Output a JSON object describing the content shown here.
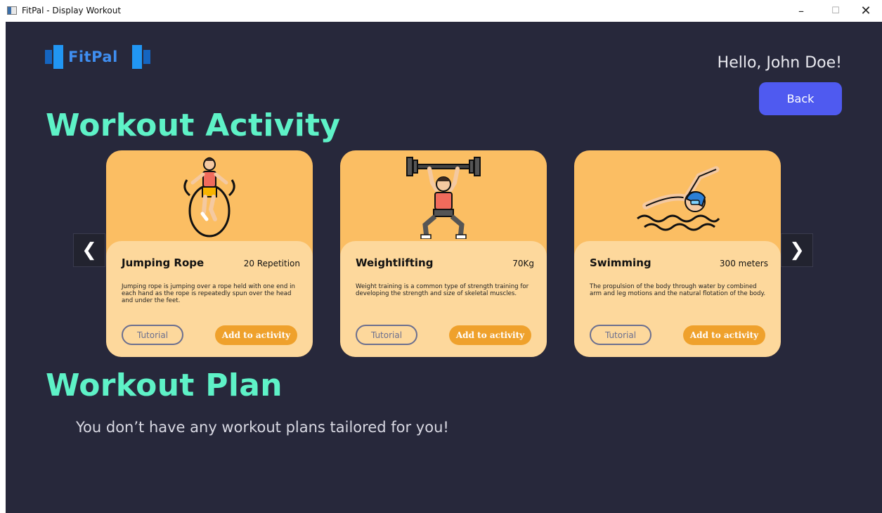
{
  "window": {
    "title": "FitPal - Display Workout",
    "minimize": "–",
    "maximize": "☐",
    "close": "✕"
  },
  "header": {
    "logo_text": "FitPal",
    "greeting": "Hello, John Doe!",
    "back_label": "Back"
  },
  "sections": {
    "activity_title": "Workout Activity",
    "plan_title": "Workout Plan",
    "plan_empty": "You don’t have any workout plans tailored for you!"
  },
  "carousel": {
    "prev": "❮",
    "next": "❯",
    "cards": [
      {
        "name": "Jumping Rope",
        "metric": "20 Repetition",
        "description": "Jumping rope is jumping over a rope held with one end in each hand as the rope is repeatedly spun over the head and under the feet.",
        "tutorial_label": "Tutorial",
        "add_label": "Add to activity",
        "icon": "jump-rope-icon"
      },
      {
        "name": "Weightlifting",
        "metric": "70Kg",
        "description": "Weight training is a common type of strength training for developing the strength and size of skeletal muscles.",
        "tutorial_label": "Tutorial",
        "add_label": "Add to activity",
        "icon": "weightlifting-icon"
      },
      {
        "name": "Swimming",
        "metric": "300 meters",
        "description": "The propulsion of the body through water by combined arm and leg motions and the natural flotation of the body.",
        "tutorial_label": "Tutorial",
        "add_label": "Add to activity",
        "icon": "swimming-icon"
      }
    ]
  },
  "colors": {
    "background": "#27283b",
    "accent_title": "#5ef2c7",
    "back_button": "#4f5af0",
    "card_top": "#fbbe63",
    "card_body": "#fdd89c",
    "add_button": "#efa12c"
  }
}
